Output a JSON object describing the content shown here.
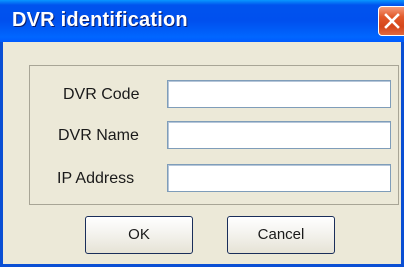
{
  "window": {
    "title": "DVR identification",
    "close_icon": "close-icon"
  },
  "form": {
    "fields": [
      {
        "label": "DVR Code",
        "value": "",
        "placeholder": ""
      },
      {
        "label": "DVR Name",
        "value": "",
        "placeholder": ""
      },
      {
        "label": "IP Address",
        "value": "",
        "placeholder": ""
      }
    ]
  },
  "buttons": {
    "ok": "OK",
    "cancel": "Cancel"
  },
  "colors": {
    "titlebar": "#0053ee",
    "close": "#d5461b",
    "dialog_bg": "#ece9d8",
    "frame": "#0a4fd4"
  }
}
